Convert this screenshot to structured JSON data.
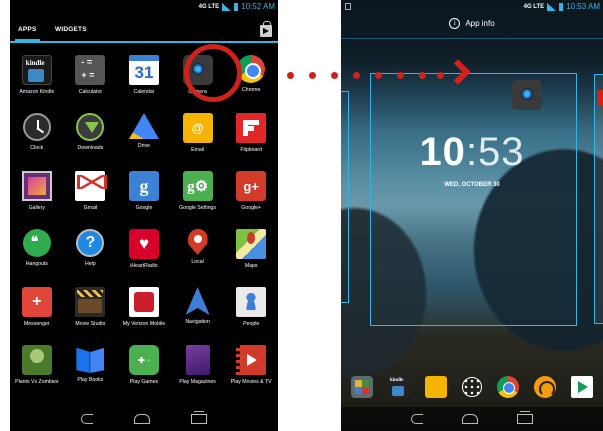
{
  "left_screen": {
    "status_bar": {
      "network": "4G LTE",
      "time": "10:52 AM"
    },
    "tabs": {
      "apps": "APPS",
      "widgets": "WIDGETS"
    },
    "apps": [
      {
        "label": "Amazon Kindle",
        "icon": "kindle-icon",
        "cls": "i-kindle sq"
      },
      {
        "label": "Calculator",
        "icon": "calculator-icon",
        "cls": "i-calc"
      },
      {
        "label": "Calendar",
        "icon": "calendar-icon",
        "cls": "i-cal",
        "glyph": "31"
      },
      {
        "label": "Camera",
        "icon": "camera-icon",
        "cls": "i-cam"
      },
      {
        "label": "Chrome",
        "icon": "chrome-icon",
        "cls": "i-chrome"
      },
      {
        "label": "Clock",
        "icon": "clock-icon",
        "cls": "i-clock"
      },
      {
        "label": "Downloads",
        "icon": "downloads-icon",
        "cls": "i-down"
      },
      {
        "label": "Drive",
        "icon": "drive-icon",
        "cls": "i-drive"
      },
      {
        "label": "Email",
        "icon": "email-icon",
        "cls": "i-email"
      },
      {
        "label": "Flipboard",
        "icon": "flipboard-icon",
        "cls": "i-flip"
      },
      {
        "label": "Gallery",
        "icon": "gallery-icon",
        "cls": "i-gallery"
      },
      {
        "label": "Gmail",
        "icon": "gmail-icon",
        "cls": "i-gmail"
      },
      {
        "label": "Google",
        "icon": "google-icon",
        "cls": "i-google",
        "glyph": "g"
      },
      {
        "label": "Google Settings",
        "icon": "google-settings-icon",
        "cls": "i-gsettings",
        "glyph": "g⚙"
      },
      {
        "label": "Google+",
        "icon": "google-plus-icon",
        "cls": "i-gplus",
        "glyph": "g+"
      },
      {
        "label": "Hangouts",
        "icon": "hangouts-icon",
        "cls": "i-hangouts"
      },
      {
        "label": "Help",
        "icon": "help-icon",
        "cls": "i-help",
        "glyph": "?"
      },
      {
        "label": "iHeartRadio",
        "icon": "iheartradio-icon",
        "cls": "i-iheart"
      },
      {
        "label": "Local",
        "icon": "local-pin-icon",
        "cls": "i-local"
      },
      {
        "label": "Maps",
        "icon": "maps-icon",
        "cls": "i-maps"
      },
      {
        "label": "Messenger",
        "icon": "messenger-icon",
        "cls": "i-messenger"
      },
      {
        "label": "Movie Studio",
        "icon": "movie-studio-icon",
        "cls": "i-moviestudio"
      },
      {
        "label": "My Verizon Mobile",
        "icon": "my-verizon-icon",
        "cls": "i-verizon"
      },
      {
        "label": "Navigation",
        "icon": "navigation-icon",
        "cls": "i-nav"
      },
      {
        "label": "People",
        "icon": "people-icon",
        "cls": "i-people"
      },
      {
        "label": "Plants Vs Zombies",
        "icon": "plants-vs-zombies-icon",
        "cls": "i-pvz"
      },
      {
        "label": "Play Books",
        "icon": "play-books-icon",
        "cls": "i-books"
      },
      {
        "label": "Play Games",
        "icon": "play-games-icon",
        "cls": "i-games"
      },
      {
        "label": "Play Magazines",
        "icon": "play-magazines-icon",
        "cls": "i-mags"
      },
      {
        "label": "Play Movies & TV",
        "icon": "play-movies-icon",
        "cls": "i-movies"
      }
    ]
  },
  "right_screen": {
    "status_bar": {
      "network": "4G LTE",
      "time": "10:53 AM"
    },
    "app_info": "App info",
    "clock": {
      "hours": "10",
      "minutes": ":53"
    },
    "date": "WED, OCTOBER 30",
    "hotseat": [
      {
        "icon": "apps-folder-icon",
        "cls": "hs-folder"
      },
      {
        "icon": "kindle-icon",
        "cls": "hs-kindle"
      },
      {
        "icon": "email-icon",
        "cls": "hs-email"
      },
      {
        "icon": "all-apps-icon",
        "cls": "hs-apps"
      },
      {
        "icon": "chrome-icon",
        "cls": "hs-chrome"
      },
      {
        "icon": "play-music-icon",
        "cls": "hs-music"
      },
      {
        "icon": "play-store-icon",
        "cls": "hs-store"
      }
    ]
  },
  "colors": {
    "accent": "#33b5e5",
    "highlight": "#d0211b"
  }
}
